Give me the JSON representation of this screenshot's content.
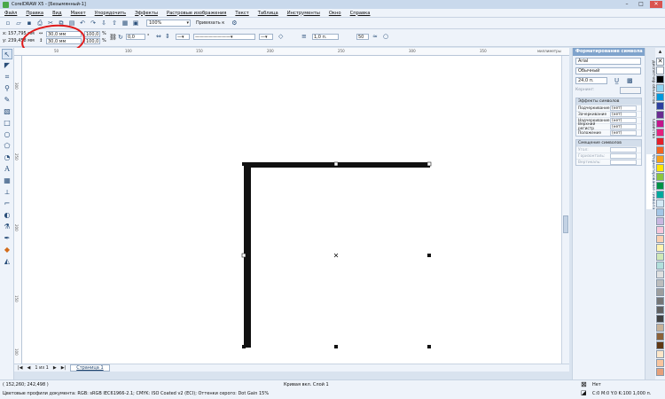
{
  "window": {
    "title": "CorelDRAW X5 - [Безымянный-1]",
    "min": "–",
    "max": "□",
    "close": "✕"
  },
  "menu": [
    "Файл",
    "Правка",
    "Вид",
    "Макет",
    "Упорядочить",
    "Эффекты",
    "Растровые изображения",
    "Текст",
    "Таблица",
    "Инструменты",
    "Окно",
    "Справка"
  ],
  "toolbar": {
    "zoom": "100%",
    "snap": "Привязать к"
  },
  "propbar": {
    "x_label": "x:",
    "x_value": "157,795 мм",
    "y_label": "y:",
    "y_value": "239,458 мм",
    "w_value": "30,0 мм",
    "h_value": "30,0 мм",
    "scale_x": "100,0",
    "scale_y": "100,0",
    "percent": "%",
    "angle": "0,0",
    "angle_unit": "°",
    "outline": "1,0 п.",
    "num1": "50"
  },
  "ruler": {
    "h_ticks": [
      "50",
      "100",
      "150",
      "200",
      "250",
      "300",
      "350",
      "миллиметры"
    ],
    "v_ticks": [
      "300",
      "250",
      "200",
      "150",
      "100"
    ]
  },
  "pagenav": {
    "first": "|◀",
    "prev": "◀",
    "counter": "1 из 1",
    "next": "▶",
    "last": "▶|",
    "tab": "Страница 1"
  },
  "status": {
    "coords": "( 152,260; 242,498 )",
    "object": "Кривая вкл. Слой 1",
    "profile": "Цветовые профили документа: RGB: sRGB IEC61966-2.1; CMYK: ISO Coated v2 (ECI); Оттенки серого: Dot Gain 15%",
    "fill": "Нет",
    "outline": "C:0 M:0 Y:0 K:100  1,000 п."
  },
  "docker": {
    "title": "Форматирование символа",
    "font": "Arial",
    "style": "Обычный",
    "size": "24,0 п.",
    "kerning_label": "Кернинг:",
    "effects_title": "Эффекты символов",
    "effects": [
      {
        "label": "Подчеркивание",
        "value": "(нет)"
      },
      {
        "label": "Зачеркивание",
        "value": "(нет)"
      },
      {
        "label": "Надчеркивание",
        "value": "(нет)"
      },
      {
        "label": "Верхний регистр",
        "value": "(нет)"
      },
      {
        "label": "Положение",
        "value": "(нет)"
      }
    ],
    "shift_title": "Смещение символов",
    "shift": [
      {
        "label": "Угол:",
        "value": ""
      },
      {
        "label": "Горизонталь:",
        "value": ""
      },
      {
        "label": "Вертикаль:",
        "value": ""
      }
    ],
    "side_tabs": [
      "Диспетчер объектов",
      "Свойства",
      "Форматирование символа"
    ]
  },
  "palette_colors": [
    "#ffffff",
    "#000000",
    "#8fd3f0",
    "#0099dd",
    "#2d3f9f",
    "#6a2c91",
    "#c4168c",
    "#e5217d",
    "#e4202a",
    "#f26522",
    "#f7a11a",
    "#ffe600",
    "#8cc63f",
    "#009245",
    "#00a99d",
    "#d4e9f5",
    "#a3c6e6",
    "#c9b7e0",
    "#f7c6d9",
    "#fbd0b0",
    "#fff3b0",
    "#cfe8b7",
    "#b2dfdb",
    "#e0e0e0",
    "#bdbdbd",
    "#9e9e9e",
    "#757575",
    "#616161",
    "#424242",
    "#c7b299",
    "#8c6239",
    "#603813",
    "#fde6c8",
    "#f9c59e",
    "#e6a07a"
  ]
}
